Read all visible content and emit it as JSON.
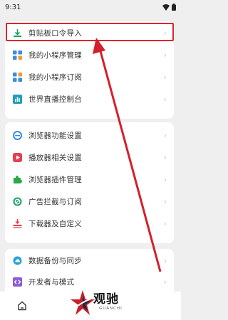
{
  "status_bar": {
    "time": "9:31"
  },
  "card1": {
    "items": [
      {
        "label": "剪贴板口令导入",
        "icon": "download-tray-icon"
      },
      {
        "label": "我的小程序管理",
        "icon": "grid-apps-icon"
      },
      {
        "label": "我的小程序订阅",
        "icon": "grid-apps-icon"
      },
      {
        "label": "世界直播控制台",
        "icon": "bar-chart-icon"
      }
    ]
  },
  "card2": {
    "items": [
      {
        "label": "浏览器功能设置",
        "icon": "browser-e-icon"
      },
      {
        "label": "播放器相关设置",
        "icon": "play-icon"
      },
      {
        "label": "浏览器插件管理",
        "icon": "puzzle-icon"
      },
      {
        "label": "广告拦截与订阅",
        "icon": "block-icon"
      },
      {
        "label": "下载器及自定义",
        "icon": "download-stack-icon"
      }
    ]
  },
  "card3": {
    "items": [
      {
        "label": "数据备份与同步",
        "icon": "cloud-icon"
      },
      {
        "label": "开发者与模式",
        "icon": "code-icon"
      }
    ]
  },
  "watermark": {
    "title": "观驰",
    "subtitle": "GUANCHI"
  },
  "colors": {
    "accent_red": "#e0242b",
    "green": "#1aa260",
    "blue": "#3a8dde",
    "orange": "#f29a2e"
  }
}
